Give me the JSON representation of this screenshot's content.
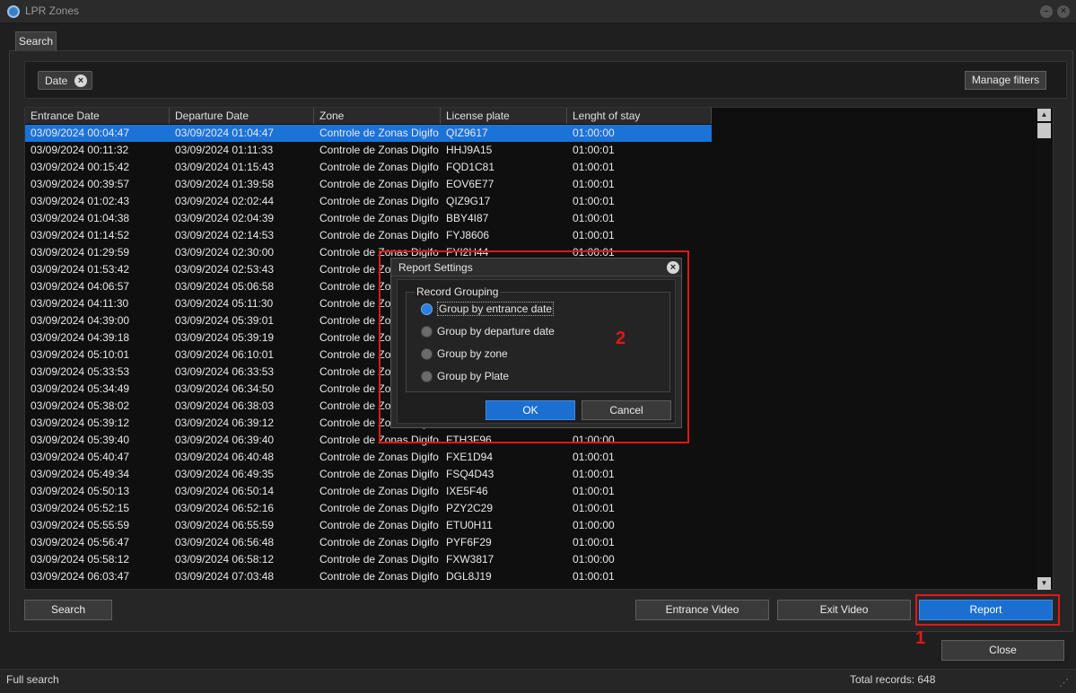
{
  "window": {
    "title": "LPR Zones"
  },
  "tabs": [
    {
      "label": "Search"
    }
  ],
  "filters": {
    "chips": [
      {
        "label": "Date"
      }
    ],
    "manage_label": "Manage filters"
  },
  "grid": {
    "columns": [
      "Entrance Date",
      "Departure Date",
      "Zone",
      "License plate",
      "Lenght of stay"
    ],
    "rows": [
      [
        "03/09/2024 00:04:47",
        "03/09/2024 01:04:47",
        "Controle de Zonas Digifo",
        "QIZ9617",
        "01:00:00"
      ],
      [
        "03/09/2024 00:11:32",
        "03/09/2024 01:11:33",
        "Controle de Zonas Digifo",
        "HHJ9A15",
        "01:00:01"
      ],
      [
        "03/09/2024 00:15:42",
        "03/09/2024 01:15:43",
        "Controle de Zonas Digifo",
        "FQD1C81",
        "01:00:01"
      ],
      [
        "03/09/2024 00:39:57",
        "03/09/2024 01:39:58",
        "Controle de Zonas Digifo",
        "EOV6E77",
        "01:00:01"
      ],
      [
        "03/09/2024 01:02:43",
        "03/09/2024 02:02:44",
        "Controle de Zonas Digifo",
        "QIZ9G17",
        "01:00:01"
      ],
      [
        "03/09/2024 01:04:38",
        "03/09/2024 02:04:39",
        "Controle de Zonas Digifo",
        "BBY4I87",
        "01:00:01"
      ],
      [
        "03/09/2024 01:14:52",
        "03/09/2024 02:14:53",
        "Controle de Zonas Digifo",
        "FYJ8606",
        "01:00:01"
      ],
      [
        "03/09/2024 01:29:59",
        "03/09/2024 02:30:00",
        "Controle de Zonas Digifo",
        "FYI2H44",
        "01:00:01"
      ],
      [
        "03/09/2024 01:53:42",
        "03/09/2024 02:53:43",
        "Controle de Zonas Digifo",
        "",
        ""
      ],
      [
        "03/09/2024 04:06:57",
        "03/09/2024 05:06:58",
        "Controle de Zonas Digifo",
        "",
        ""
      ],
      [
        "03/09/2024 04:11:30",
        "03/09/2024 05:11:30",
        "Controle de Zonas Digifo",
        "",
        ""
      ],
      [
        "03/09/2024 04:39:00",
        "03/09/2024 05:39:01",
        "Controle de Zonas Digifo",
        "",
        ""
      ],
      [
        "03/09/2024 04:39:18",
        "03/09/2024 05:39:19",
        "Controle de Zonas Digifo",
        "",
        ""
      ],
      [
        "03/09/2024 05:10:01",
        "03/09/2024 06:10:01",
        "Controle de Zonas Digifo",
        "",
        ""
      ],
      [
        "03/09/2024 05:33:53",
        "03/09/2024 06:33:53",
        "Controle de Zonas Digifo",
        "",
        ""
      ],
      [
        "03/09/2024 05:34:49",
        "03/09/2024 06:34:50",
        "Controle de Zonas Digifo",
        "",
        ""
      ],
      [
        "03/09/2024 05:38:02",
        "03/09/2024 06:38:03",
        "Controle de Zonas Digifo",
        "",
        ""
      ],
      [
        "03/09/2024 05:39:12",
        "03/09/2024 06:39:12",
        "Controle de Zonas Digifo",
        "",
        ""
      ],
      [
        "03/09/2024 05:39:40",
        "03/09/2024 06:39:40",
        "Controle de Zonas Digifo",
        "FTH3F96",
        "01:00:00"
      ],
      [
        "03/09/2024 05:40:47",
        "03/09/2024 06:40:48",
        "Controle de Zonas Digifo",
        "FXE1D94",
        "01:00:01"
      ],
      [
        "03/09/2024 05:49:34",
        "03/09/2024 06:49:35",
        "Controle de Zonas Digifo",
        "FSQ4D43",
        "01:00:01"
      ],
      [
        "03/09/2024 05:50:13",
        "03/09/2024 06:50:14",
        "Controle de Zonas Digifo",
        "IXE5F46",
        "01:00:01"
      ],
      [
        "03/09/2024 05:52:15",
        "03/09/2024 06:52:16",
        "Controle de Zonas Digifo",
        "PZY2C29",
        "01:00:01"
      ],
      [
        "03/09/2024 05:55:59",
        "03/09/2024 06:55:59",
        "Controle de Zonas Digifo",
        "ETU0H11",
        "01:00:00"
      ],
      [
        "03/09/2024 05:56:47",
        "03/09/2024 06:56:48",
        "Controle de Zonas Digifo",
        "PYF6F29",
        "01:00:01"
      ],
      [
        "03/09/2024 05:58:12",
        "03/09/2024 06:58:12",
        "Controle de Zonas Digifo",
        "FXW3817",
        "01:00:00"
      ],
      [
        "03/09/2024 06:03:47",
        "03/09/2024 07:03:48",
        "Controle de Zonas Digifo",
        "DGL8J19",
        "01:00:01"
      ]
    ]
  },
  "actions": {
    "search_label": "Search",
    "entrance_video_label": "Entrance Video",
    "exit_video_label": "Exit Video",
    "report_label": "Report",
    "close_label": "Close"
  },
  "annotations": {
    "marker_1": "1",
    "marker_2": "2"
  },
  "dialog": {
    "title": "Report Settings",
    "group_title": "Record Grouping",
    "options": [
      {
        "label": "Group by entrance date",
        "checked": true
      },
      {
        "label": "Group by departure date",
        "checked": false
      },
      {
        "label": "Group by zone",
        "checked": false
      },
      {
        "label": "Group by Plate",
        "checked": false
      }
    ],
    "ok_label": "OK",
    "cancel_label": "Cancel"
  },
  "status": {
    "left_text": "Full search",
    "right_text": "Total records: 648"
  },
  "colors": {
    "accent": "#1b73d8",
    "highlight": "#e11818"
  }
}
